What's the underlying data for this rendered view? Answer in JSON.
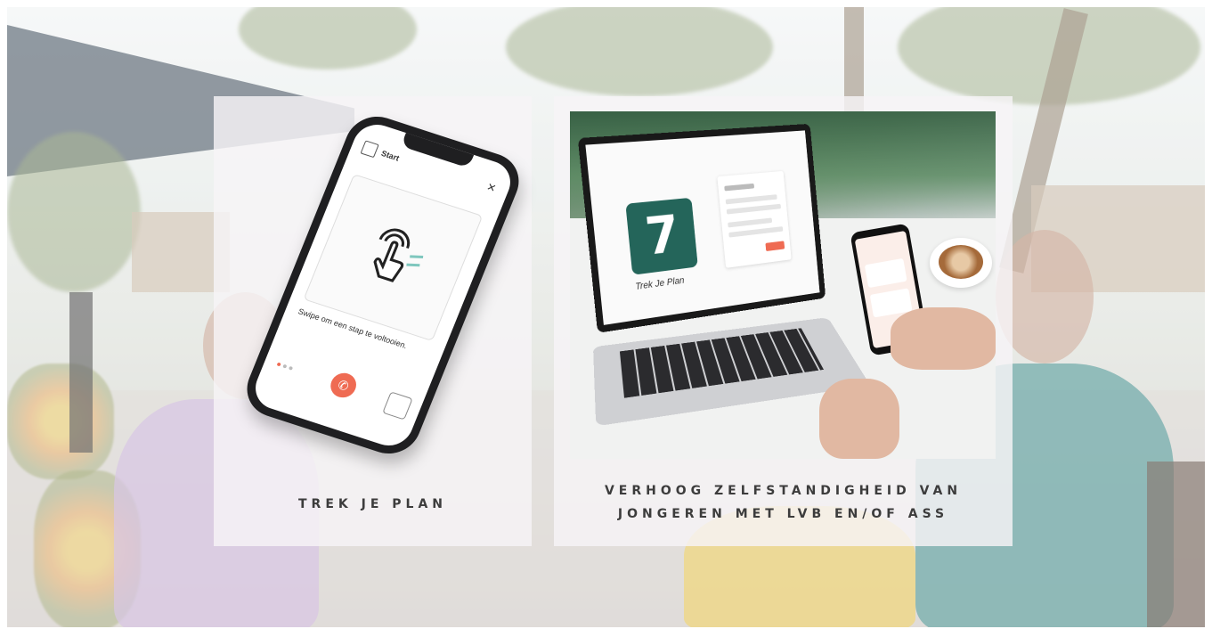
{
  "left_panel": {
    "caption": "TREK JE PLAN",
    "phone": {
      "header_label": "Start",
      "close_icon": "close-icon",
      "card_icon": "swipe-hand-icon",
      "card_text": "Swipe om een stap te voltooien.",
      "call_icon": "phone-icon",
      "accent_color": "#ef6b53"
    }
  },
  "right_panel": {
    "caption_line1": "VERHOOG ZELFSTANDIGHEID VAN",
    "caption_line2": "JONGEREN MET LVB EN/OF ASS",
    "laptop": {
      "app_logo_text": "7",
      "app_name": "Trek Je Plan",
      "brand_color": "#24655a"
    }
  }
}
